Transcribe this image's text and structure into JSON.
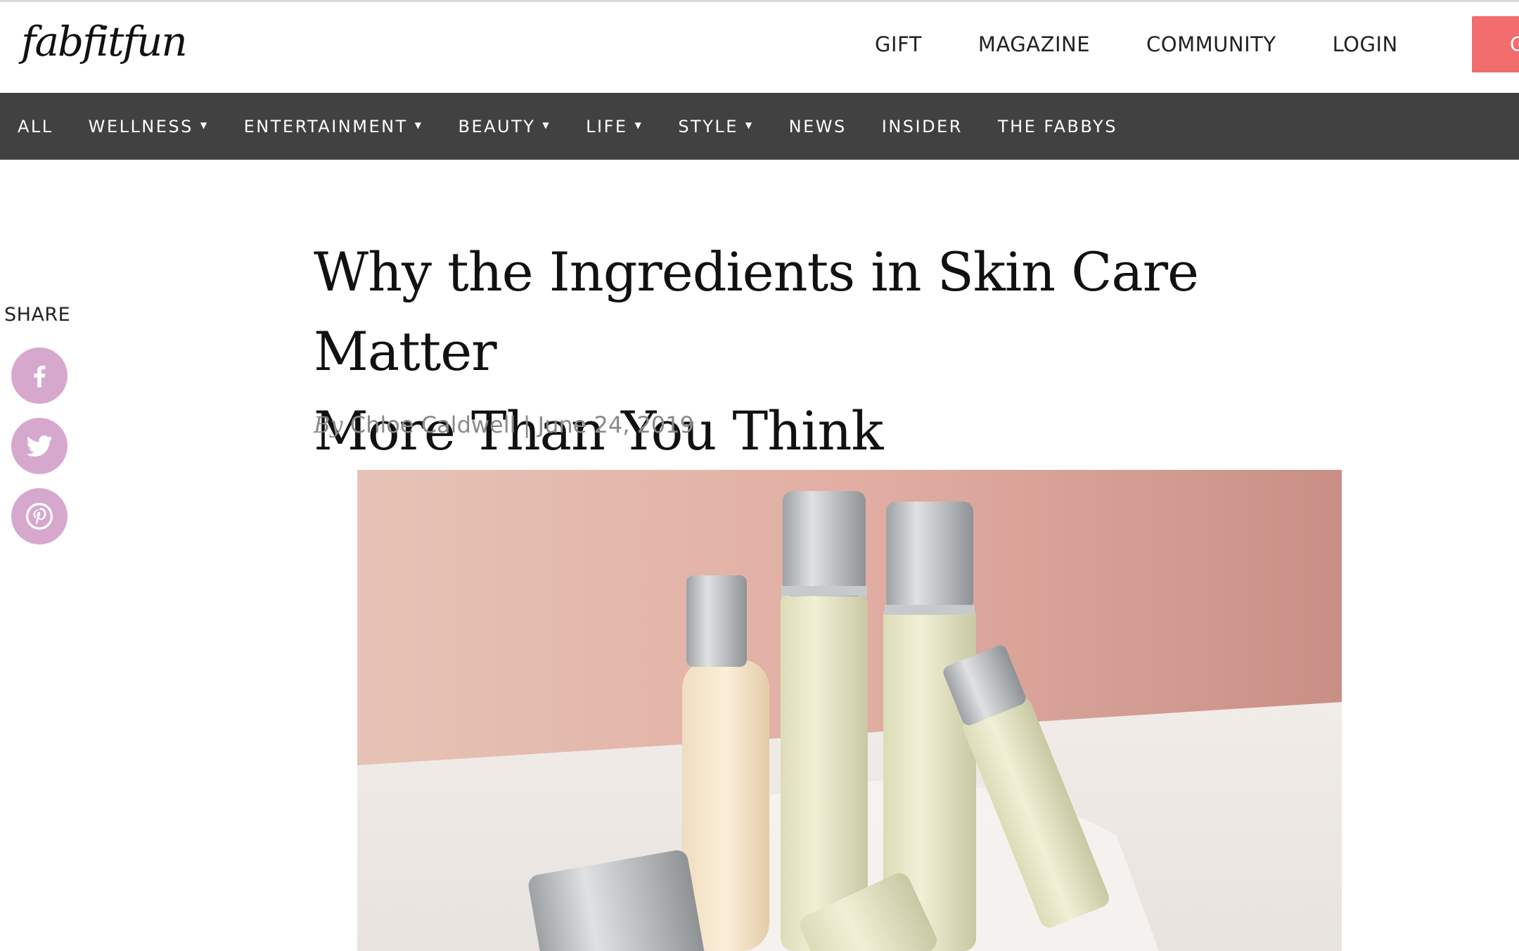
{
  "header": {
    "logo_text": "fabfitfun",
    "nav": [
      "GIFT",
      "MAGAZINE",
      "COMMUNITY",
      "LOGIN"
    ],
    "cta_label": "GET",
    "cta_color": "#f26d6d"
  },
  "categories": [
    {
      "label": "ALL",
      "has_dropdown": false
    },
    {
      "label": "WELLNESS",
      "has_dropdown": true
    },
    {
      "label": "ENTERTAINMENT",
      "has_dropdown": true
    },
    {
      "label": "BEAUTY",
      "has_dropdown": true
    },
    {
      "label": "LIFE",
      "has_dropdown": true
    },
    {
      "label": "STYLE",
      "has_dropdown": true
    },
    {
      "label": "NEWS",
      "has_dropdown": false
    },
    {
      "label": "INSIDER",
      "has_dropdown": false
    },
    {
      "label": "THE FABBYS",
      "has_dropdown": false
    }
  ],
  "share": {
    "label": "SHARE",
    "buttons": [
      "facebook-icon",
      "twitter-icon",
      "pinterest-icon"
    ],
    "color": "#d7a8cd"
  },
  "article": {
    "title_line1": "Why the Ingredients in Skin Care Matter",
    "title_line2": "More Than You Think",
    "by_label": "By",
    "author": "Chloe Caldwell",
    "date": "June 24, 2019"
  },
  "colors": {
    "nav_bar": "#414141",
    "accent": "#f26d6d"
  }
}
